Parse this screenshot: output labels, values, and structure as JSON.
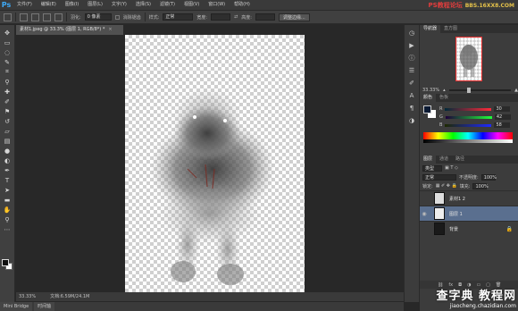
{
  "app": {
    "logo": "Ps"
  },
  "menu": [
    "文件(F)",
    "编辑(E)",
    "图像(I)",
    "图层(L)",
    "文字(Y)",
    "选择(S)",
    "滤镜(T)",
    "视图(V)",
    "窗口(W)",
    "帮助(H)"
  ],
  "watermark_top": {
    "text": "PS教程论坛",
    "site": "BBS.16XX8.COM"
  },
  "options": {
    "feather_label": "羽化:",
    "feather_value": "0 像素",
    "antialias_label": "消除锯齿",
    "style_label": "样式:",
    "style_value": "正常",
    "width_label": "宽度:",
    "height_label": "高度:",
    "refine_button": "调整边缘..."
  },
  "document": {
    "tab_title": "素材1.jpeg @ 33.3% (图层 1, RGB/8*) *",
    "close_glyph": "×"
  },
  "status": {
    "zoom": "33.33%",
    "doc_size": "文档:6.59M/24.1M"
  },
  "bottom_tabs": [
    "Mini Bridge",
    "时间轴"
  ],
  "panels": {
    "navigator_tabs": [
      "导航器",
      "直方图"
    ],
    "nav_zoom": "33.33%",
    "color_tabs": [
      "颜色",
      "色板"
    ],
    "color_values": {
      "r": "30",
      "g": "42",
      "b": "58"
    },
    "fg_color": "#1e2a3a",
    "layer_tabs": [
      "图层",
      "通道",
      "路径"
    ],
    "layer_kind": "类型",
    "blend_mode": "正常",
    "opacity_label": "不透明度:",
    "opacity_value": "100%",
    "lock_label": "锁定:",
    "fill_label": "填充:",
    "fill_value": "100%",
    "layers": [
      {
        "name": "素材1 2",
        "visible": false,
        "selected": false
      },
      {
        "name": "图层 1",
        "visible": true,
        "selected": true
      },
      {
        "name": "背景",
        "visible": false,
        "selected": false
      }
    ]
  },
  "watermark_bottom": {
    "big": "查字典 教程网",
    "small": "jiaocheng.chazidian.com"
  }
}
